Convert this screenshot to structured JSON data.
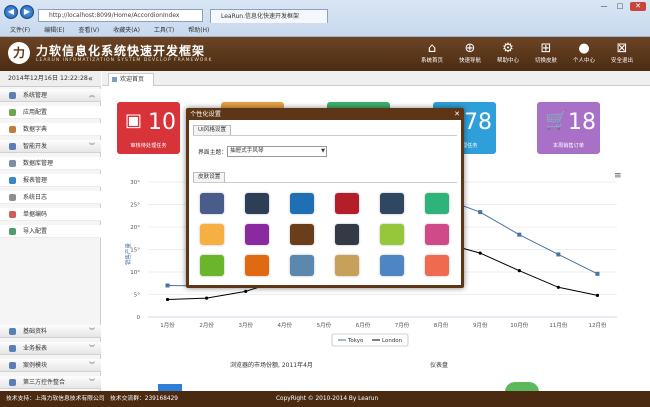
{
  "browser": {
    "address": "http://localhost:8099/Home/AccordionIndex",
    "tab_label": "LeaRun.信息化快速开发框架",
    "menus": [
      "文件(F)",
      "编辑(E)",
      "查看(V)",
      "收藏夹(A)",
      "工具(T)",
      "帮助(H)"
    ]
  },
  "header": {
    "title": "力软信息化系统快速开发框架",
    "subtitle": "LEARUN  INFOMATIZATION  SYSTEM  DEVELOP  FRAMEWORK",
    "nav": [
      {
        "label": "系统首页",
        "icon": "home-icon"
      },
      {
        "label": "快速导航",
        "icon": "compass-icon"
      },
      {
        "label": "帮助中心",
        "icon": "gear-icon"
      },
      {
        "label": "切换皮肤",
        "icon": "grid-icon"
      },
      {
        "label": "个人中心",
        "icon": "user-icon"
      },
      {
        "label": "安全退出",
        "icon": "exit-icon"
      }
    ]
  },
  "sidebar": {
    "datetime": "2014年12月16日 12:22:28",
    "collapse_glyph": "«",
    "groups": [
      {
        "label": "系统管理",
        "items": [
          "应用配置",
          "数据字典"
        ]
      },
      {
        "label": "智能开发",
        "items": [
          "数据库管理",
          "报表管理",
          "系统日志",
          "单据编码",
          "导入配置"
        ]
      }
    ],
    "bottom_groups": [
      "基础资料",
      "业务报表",
      "案例模块",
      "第三方控件整合"
    ]
  },
  "main": {
    "tab_label": "欢迎首页",
    "cards": [
      {
        "value": "10",
        "label": "审核待处理任务",
        "color": "#d9333a"
      },
      {
        "value": "",
        "label": "",
        "color": "#e8a045"
      },
      {
        "value": "",
        "label": "",
        "color": "#3cb06a"
      },
      {
        "value": "78",
        "label": "待处理任务",
        "color": "#2f9fd9"
      },
      {
        "value": "18",
        "label": "本周销售订单",
        "color": "#a970c8"
      }
    ],
    "chart_left_title": "浏览器的市场份额, 2011年4月",
    "chart_right_title": "仪表盘"
  },
  "chart_data": {
    "type": "line",
    "categories": [
      "1月份",
      "2月份",
      "3月份",
      "4月份",
      "5月份",
      "6月份",
      "7月份",
      "8月份",
      "9月份",
      "10月份",
      "11月份",
      "12月份"
    ],
    "ylabel": "销售产量",
    "ylim": [
      0,
      30
    ],
    "yticks": [
      "0",
      "5°",
      "10°",
      "15°",
      "20°",
      "25°",
      "30°"
    ],
    "series": [
      {
        "name": "Tokyo",
        "color": "#4572a7",
        "values": [
          7.0,
          6.9,
          9.5,
          14.5,
          18.2,
          21.5,
          25.2,
          26.5,
          23.3,
          18.3,
          13.9,
          9.6
        ]
      },
      {
        "name": "London",
        "color": "#000000",
        "values": [
          3.9,
          4.2,
          5.7,
          8.5,
          11.9,
          15.2,
          17.0,
          16.6,
          14.2,
          10.3,
          6.6,
          4.8
        ]
      }
    ],
    "legend_position": "bottom-center",
    "grid": true
  },
  "modal": {
    "title": "个性化设置",
    "close_glyph": "✕",
    "ui_tab": "UI风格设置",
    "theme_label": "界面主题：",
    "theme_value": "抽屉式手风琴",
    "skin_tab": "皮肤设置",
    "swatches": [
      "#4a5d8a",
      "#2d3e57",
      "#1e6fb4",
      "#b31e2a",
      "#2f4761",
      "#2eb37a",
      "#f5b041",
      "#8a2aa0",
      "#6b3e1b",
      "#333a45",
      "#96c73b",
      "#d04a8a",
      "#6bb52c",
      "#e06a12",
      "#5c88ad",
      "#c7a05a",
      "#4e86c4",
      "#ef6a4e"
    ]
  },
  "footer": {
    "support": "技术支持：上海力软信息技术有限公司",
    "qq": "技术交流群：239168429",
    "copyright": "CopyRight © 2010-2014 By Learun"
  }
}
